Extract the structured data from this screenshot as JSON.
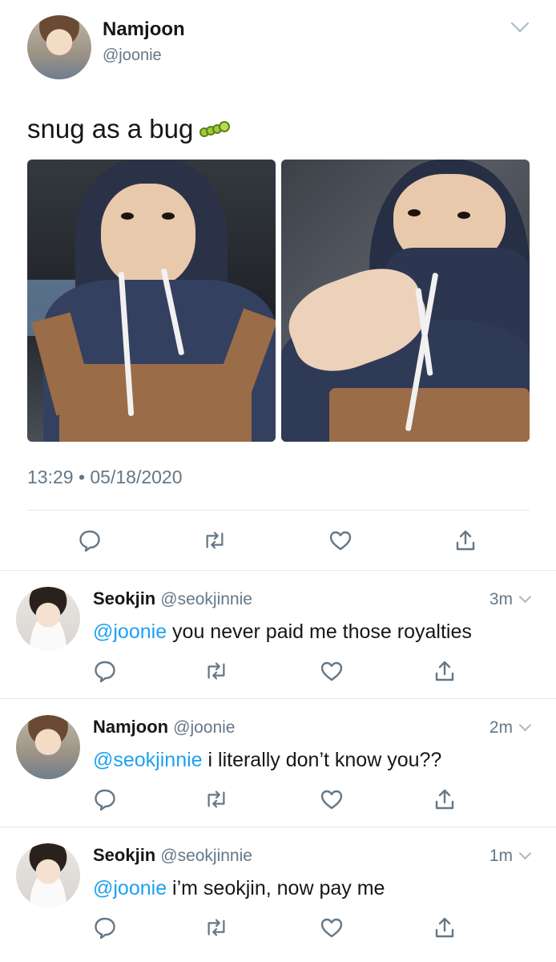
{
  "tweet": {
    "author_name": "Namjoon",
    "author_handle": "@joonie",
    "text": "snug as a bug",
    "emoji_icon": "caterpillar-emoji",
    "timestamp": "13:29 • 05/18/2020",
    "photos": [
      "hoodie-selfie-photo-1",
      "hoodie-selfie-photo-2"
    ]
  },
  "actions": {
    "reply_icon": "reply-icon",
    "retweet_icon": "retweet-icon",
    "like_icon": "heart-icon",
    "share_icon": "share-icon"
  },
  "replies": [
    {
      "name": "Seokjin",
      "handle": "@seokjinnie",
      "time": "3m",
      "mention": "@joonie",
      "text": " you never paid me those royalties"
    },
    {
      "name": "Namjoon",
      "handle": "@joonie",
      "time": "2m",
      "mention": "@seokjinnie",
      "text": " i literally don’t know you??"
    },
    {
      "name": "Seokjin",
      "handle": "@seokjinnie",
      "time": "1m",
      "mention": "@joonie",
      "text": " i’m seokjin, now pay me"
    }
  ],
  "colors": {
    "accent": "#1da1f2",
    "secondary_text": "#657786",
    "icon": "#657786",
    "divider": "#e1e8ed"
  }
}
